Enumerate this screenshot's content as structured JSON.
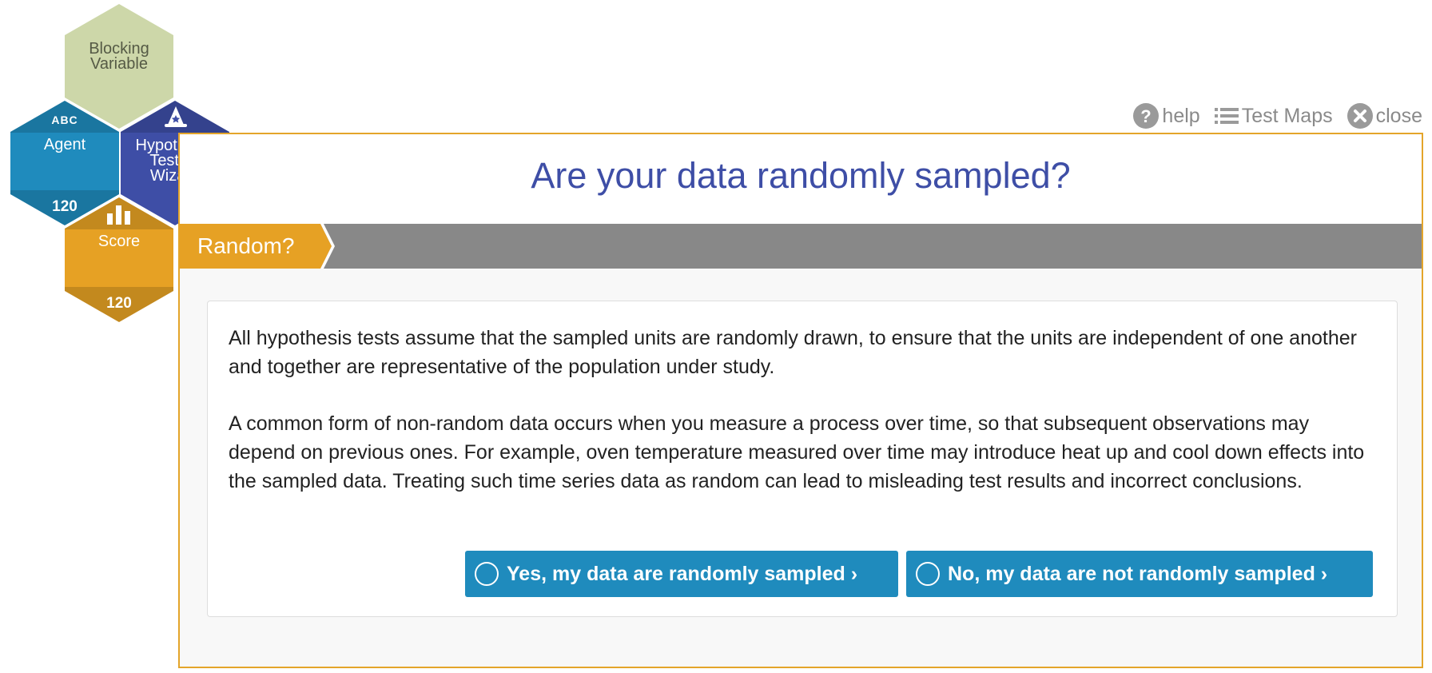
{
  "toolbar": {
    "help_label": "help",
    "test_maps_label": "Test Maps",
    "close_label": "close",
    "icons": {
      "help": "question-circle-icon",
      "test_maps": "list-icon",
      "close": "x-circle-icon"
    }
  },
  "hexes": {
    "blocking": {
      "label_line1": "Blocking",
      "label_line2": "Variable"
    },
    "agent": {
      "abc": "ABC",
      "label": "Agent",
      "count": "120"
    },
    "wizard": {
      "label_line1": "Hypothesis",
      "label_line2": "Testing",
      "label_line3": "Wizard",
      "icon": "wizard-hat-icon"
    },
    "score": {
      "label": "Score",
      "count": "120",
      "icon": "bar-chart-icon"
    }
  },
  "panel": {
    "question": "Are your data randomly sampled?",
    "step_label": "Random?",
    "paragraph1": "All hypothesis tests assume that the sampled units are randomly drawn, to ensure that the units are independent of one another and together are representative of the population under study.",
    "paragraph2": "A common form of non-random data occurs when you measure a process over time, so that subsequent observations may depend on previous ones. For example, oven temperature measured over time may introduce heat up and cool down effects into the sampled data. Treating such time series data as random can lead to misleading test results and incorrect conclusions.",
    "yes_button": "Yes, my data are randomly sampled ›",
    "no_button": "No, my data are not randomly sampled ›"
  },
  "colors": {
    "accent_orange": "#e6a124",
    "accent_blue": "#1f8bbd",
    "wizard_indigo": "#3e4ea6",
    "blocking_green": "#cdd7a9",
    "arrow_yellow": "#f7c41b",
    "step_bar_gray": "#888888"
  }
}
